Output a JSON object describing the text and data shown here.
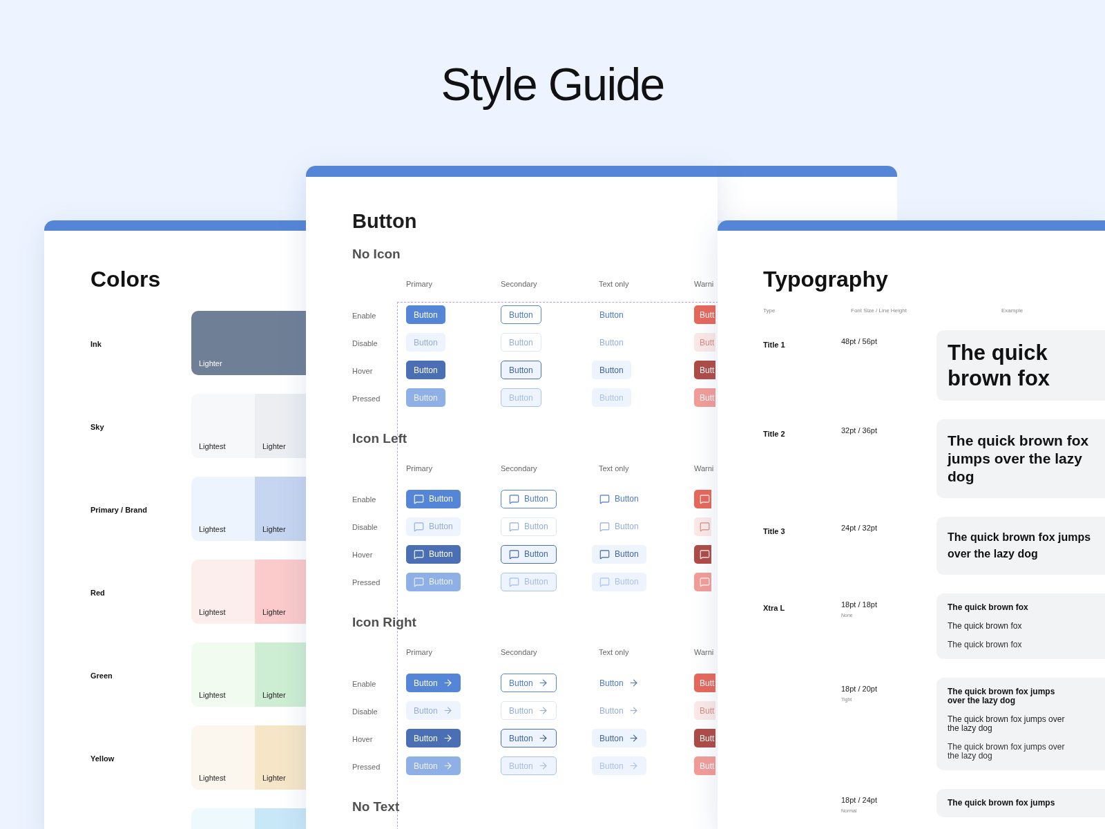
{
  "page_title": "Style Guide",
  "colors": {
    "title": "Colors",
    "rows": [
      {
        "name": "Ink",
        "swatches": [
          {
            "label": "Lighter",
            "color": "#6f7f96"
          }
        ]
      },
      {
        "name": "Sky",
        "swatches": [
          {
            "label": "Lightest",
            "color": "#f7f8fa"
          },
          {
            "label": "Lighter",
            "color": "#eceef2"
          }
        ]
      },
      {
        "name": "Primary / Brand",
        "swatches": [
          {
            "label": "Lightest",
            "color": "#eef4fe"
          },
          {
            "label": "Lighter",
            "color": "#c6d5f0"
          }
        ]
      },
      {
        "name": "Red",
        "swatches": [
          {
            "label": "Lightest",
            "color": "#fdeeee"
          },
          {
            "label": "Lighter",
            "color": "#fbcaca"
          }
        ]
      },
      {
        "name": "Green",
        "swatches": [
          {
            "label": "Lightest",
            "color": "#f2fbf0"
          },
          {
            "label": "Lighter",
            "color": "#cdeed2"
          }
        ]
      },
      {
        "name": "Yellow",
        "swatches": [
          {
            "label": "Lightest",
            "color": "#fbf6ee"
          },
          {
            "label": "Lighter",
            "color": "#f6e6c7"
          }
        ]
      },
      {
        "swatches": [
          {
            "color": "#eef9fe"
          },
          {
            "color": "#c8e7f7"
          }
        ]
      }
    ]
  },
  "button": {
    "title": "Button",
    "sections": [
      {
        "title": "No Icon",
        "kind": "no_icon",
        "columns": [
          "Primary",
          "Secondary",
          "Text only",
          "Warni"
        ],
        "rows": [
          {
            "label": "Enable",
            "kind": "enable",
            "buttons": [
              {
                "kind": "primary",
                "label": "Button"
              },
              {
                "kind": "secondary",
                "label": "Button"
              },
              {
                "kind": "text",
                "label": "Button"
              },
              {
                "kind": "warning",
                "label": "Butt"
              }
            ]
          },
          {
            "label": "Disable",
            "kind": "disable",
            "buttons": [
              {
                "kind": "primary",
                "label": "Button"
              },
              {
                "kind": "secondary",
                "label": "Button"
              },
              {
                "kind": "text",
                "label": "Button"
              },
              {
                "kind": "warning",
                "label": "Butt"
              }
            ]
          },
          {
            "label": "Hover",
            "kind": "hover",
            "buttons": [
              {
                "kind": "primary",
                "label": "Button"
              },
              {
                "kind": "secondary",
                "label": "Button"
              },
              {
                "kind": "text",
                "label": "Button"
              },
              {
                "kind": "warning",
                "label": "Butt"
              }
            ]
          },
          {
            "label": "Pressed",
            "kind": "pressed",
            "buttons": [
              {
                "kind": "primary",
                "label": "Button"
              },
              {
                "kind": "secondary",
                "label": "Button"
              },
              {
                "kind": "text",
                "label": "Button"
              },
              {
                "kind": "warning",
                "label": "Butt"
              }
            ]
          }
        ]
      },
      {
        "title": "Icon Left",
        "kind": "icon_left",
        "columns": [
          "Primary",
          "Secondary",
          "Text only",
          "Warni"
        ],
        "rows": [
          {
            "label": "Enable",
            "kind": "enable",
            "buttons": [
              {
                "kind": "primary",
                "label": "Button"
              },
              {
                "kind": "secondary",
                "label": "Button"
              },
              {
                "kind": "text",
                "label": "Button"
              },
              {
                "kind": "warning"
              }
            ]
          },
          {
            "label": "Disable",
            "kind": "disable",
            "buttons": [
              {
                "kind": "primary",
                "label": "Button"
              },
              {
                "kind": "secondary",
                "label": "Button"
              },
              {
                "kind": "text",
                "label": "Button"
              },
              {
                "kind": "warning"
              }
            ]
          },
          {
            "label": "Hover",
            "kind": "hover",
            "buttons": [
              {
                "kind": "primary",
                "label": "Button"
              },
              {
                "kind": "secondary",
                "label": "Button"
              },
              {
                "kind": "text",
                "label": "Button"
              },
              {
                "kind": "warning"
              }
            ]
          },
          {
            "label": "Pressed",
            "kind": "pressed",
            "buttons": [
              {
                "kind": "primary",
                "label": "Button"
              },
              {
                "kind": "secondary",
                "label": "Button"
              },
              {
                "kind": "text",
                "label": "Button"
              },
              {
                "kind": "warning"
              }
            ]
          }
        ]
      },
      {
        "title": "Icon Right",
        "kind": "icon_right",
        "columns": [
          "Primary",
          "Secondary",
          "Text only",
          "Warni"
        ],
        "rows": [
          {
            "label": "Enable",
            "kind": "enable",
            "buttons": [
              {
                "kind": "primary",
                "label": "Button"
              },
              {
                "kind": "secondary",
                "label": "Button"
              },
              {
                "kind": "text",
                "label": "Button"
              },
              {
                "kind": "warning",
                "label": "Butt"
              }
            ]
          },
          {
            "label": "Disable",
            "kind": "disable",
            "buttons": [
              {
                "kind": "primary",
                "label": "Button"
              },
              {
                "kind": "secondary",
                "label": "Button"
              },
              {
                "kind": "text",
                "label": "Button"
              },
              {
                "kind": "warning",
                "label": "Butt"
              }
            ]
          },
          {
            "label": "Hover",
            "kind": "hover",
            "buttons": [
              {
                "kind": "primary",
                "label": "Button"
              },
              {
                "kind": "secondary",
                "label": "Button"
              },
              {
                "kind": "text",
                "label": "Button"
              },
              {
                "kind": "warning",
                "label": "Butt"
              }
            ]
          },
          {
            "label": "Pressed",
            "kind": "pressed",
            "buttons": [
              {
                "kind": "primary",
                "label": "Button"
              },
              {
                "kind": "secondary",
                "label": "Button"
              },
              {
                "kind": "text",
                "label": "Button"
              },
              {
                "kind": "warning",
                "label": "Butt"
              }
            ]
          }
        ]
      },
      {
        "title": "No Text"
      }
    ]
  },
  "typography": {
    "title": "Typography",
    "headers": [
      "Type",
      "Font Size / Line Height",
      "Example"
    ],
    "rows": [
      {
        "type": "Title 1",
        "size": "48pt / 56pt",
        "kind": "title1",
        "examples": [
          {
            "text": "The quick brown fox",
            "kind": "bold"
          }
        ]
      },
      {
        "type": "Title 2",
        "size": "32pt / 36pt",
        "kind": "title2",
        "examples": [
          {
            "text": "The quick brown fox jumps over the lazy dog",
            "kind": "bold"
          }
        ]
      },
      {
        "type": "Title 3",
        "size": "24pt / 32pt",
        "kind": "title3",
        "examples": [
          {
            "text": "The quick brown fox jumps over the lazy dog",
            "kind": "bold"
          }
        ]
      },
      {
        "type": "Xtra L",
        "size": "18pt / 18pt",
        "note": "None",
        "kind": "body",
        "examples": [
          {
            "text": "The quick brown fox",
            "kind": "bold"
          },
          {
            "text": "The quick brown fox",
            "kind": "medium"
          },
          {
            "text": "The quick brown fox",
            "kind": "regular"
          }
        ]
      },
      {
        "size": "18pt / 20pt",
        "note": "Tight",
        "kind": "body",
        "examples": [
          {
            "text": "The quick brown fox jumps over the lazy dog",
            "kind": "bold"
          },
          {
            "text": "The quick brown fox jumps over the lazy dog",
            "kind": "medium"
          },
          {
            "text": "The quick brown fox jumps over the lazy dog",
            "kind": "regular"
          }
        ]
      },
      {
        "size": "18pt / 24pt",
        "note": "Normal",
        "kind": "body",
        "examples": [
          {
            "text": "The quick brown fox jumps",
            "kind": "bold"
          }
        ]
      }
    ]
  }
}
